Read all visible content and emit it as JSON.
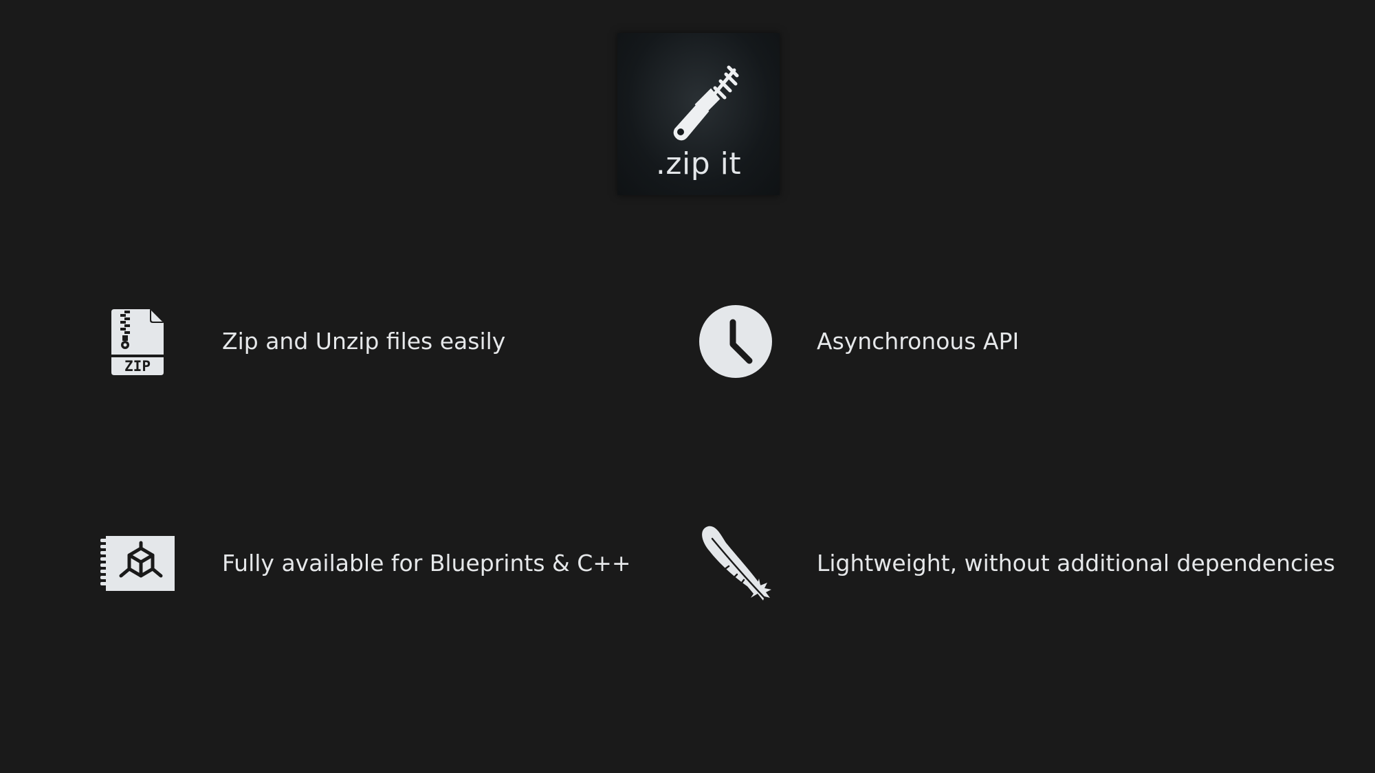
{
  "logo": {
    "text": ".zip it",
    "icon": "zipper-pull-icon"
  },
  "features": [
    {
      "icon": "zip-file-icon",
      "label": "Zip and Unzip files easily"
    },
    {
      "icon": "clock-icon",
      "label": "Asynchronous API"
    },
    {
      "icon": "blueprint-icon",
      "label": "Fully available for Blueprints & C++"
    },
    {
      "icon": "feather-icon",
      "label": "Lightweight, without additional dependencies"
    }
  ],
  "colors": {
    "background": "#1a1a1a",
    "foreground": "#e4e7ea"
  }
}
